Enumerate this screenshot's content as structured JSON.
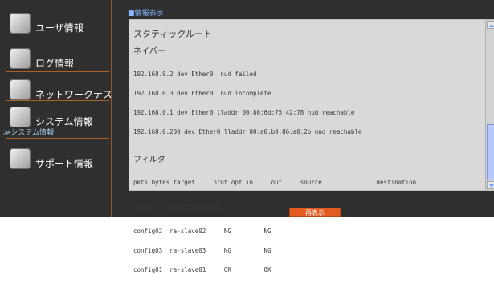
{
  "sidebar": {
    "items": [
      {
        "label": "ユーザ情報",
        "icon": "user-icon"
      },
      {
        "label": "ログ情報",
        "icon": "log-icon"
      },
      {
        "label": "ネットワークテスト",
        "icon": "network-test-icon"
      },
      {
        "label": "システム情報",
        "icon": "system-icon"
      },
      {
        "label": "サポート情報",
        "icon": "support-icon"
      }
    ],
    "sub_item": "≫システム情報"
  },
  "main": {
    "section_title": "■情報表示",
    "panel": {
      "static_route_title": "スタティックルート",
      "neighbor_title": "ネイバー",
      "neighbors": [
        "192.168.0.2 dev Ether0  nud failed",
        "192.168.0.3 dev Ether0  nud incomplete",
        "192.168.0.1 dev Ether0 lladdr 00:80:6d:75:42:78 nud reachable",
        "192.168.0.200 dev Ether0 lladdr 00:a0:b0:86:a0:2b nud reachable"
      ],
      "filter_title": "フィルタ",
      "filter_header": "pkts bytes target     prot opt in     out     source               destination",
      "sync_title": "二重化・設定情報の同期",
      "sync_rows": [
        "config02  ra-slave02     NG         NG",
        "config03  ra-slave03     NG         NG",
        "config01  ra-slave01     OK         OK"
      ]
    },
    "button_label": "再表示"
  }
}
